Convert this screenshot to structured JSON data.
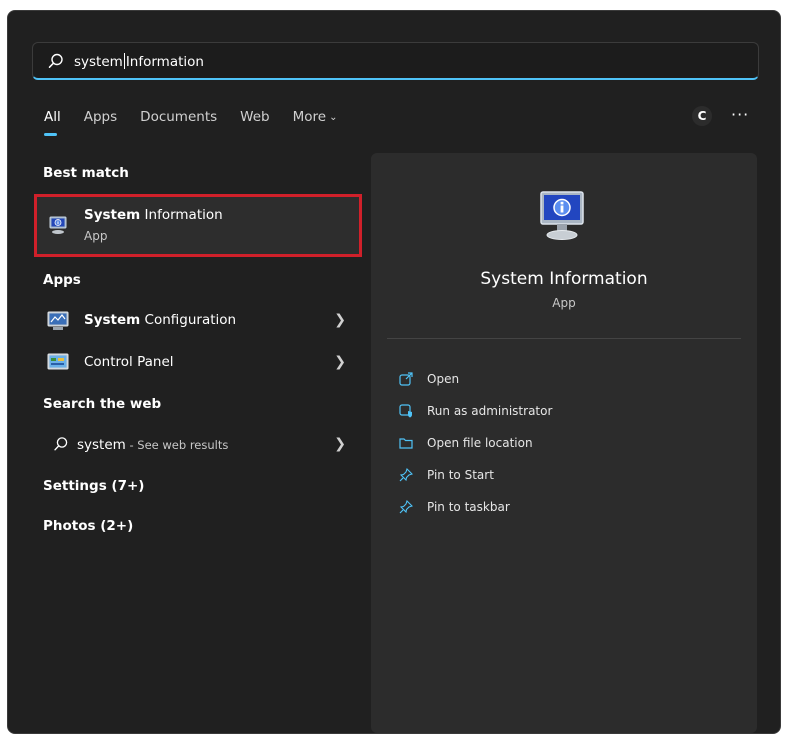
{
  "search": {
    "typed": "system",
    "suggested": "Information"
  },
  "tabs": [
    {
      "label": "All"
    },
    {
      "label": "Apps"
    },
    {
      "label": "Documents"
    },
    {
      "label": "Web"
    },
    {
      "label": "More"
    }
  ],
  "account_initial": "C",
  "more_options": "···",
  "best_match": {
    "title": "Best match",
    "item_bold": "System",
    "item_rest": " Information",
    "item_sub": "App"
  },
  "apps": {
    "title": "Apps",
    "items": [
      {
        "bold": "System",
        "rest": " Configuration"
      },
      {
        "bold": "",
        "rest": "Control Panel"
      }
    ]
  },
  "web": {
    "title": "Search the web",
    "query": "system",
    "suffix": " - See web results"
  },
  "settings": {
    "label": "Settings (7+)"
  },
  "photos": {
    "label": "Photos (2+)"
  },
  "detail": {
    "title": "System Information",
    "subtitle": "App",
    "actions": [
      {
        "label": "Open"
      },
      {
        "label": "Run as administrator"
      },
      {
        "label": "Open file location"
      },
      {
        "label": "Pin to Start"
      },
      {
        "label": "Pin to taskbar"
      }
    ]
  },
  "colors": {
    "accent": "#4fc3f7",
    "highlight_border": "#d0202a",
    "background": "#202020"
  }
}
